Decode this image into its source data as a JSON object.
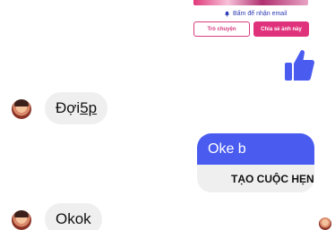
{
  "share_card": {
    "email_text": "Bấm để nhận email",
    "chat_button": "Trò chuyện",
    "share_button": "Chia sẻ ảnh này"
  },
  "messages": {
    "incoming_1_prefix": "Đợi ",
    "incoming_1_link": "5p",
    "outgoing_text": "Oke b",
    "outgoing_action": "TẠO CUỘC HẸN",
    "incoming_2": "Okok"
  },
  "colors": {
    "accent_blue": "#4a5cf0",
    "pink": "#e0327c",
    "bubble_gray": "#efefef"
  },
  "icons": {
    "like": "thumbs-up-icon",
    "bell": "bell-icon"
  }
}
